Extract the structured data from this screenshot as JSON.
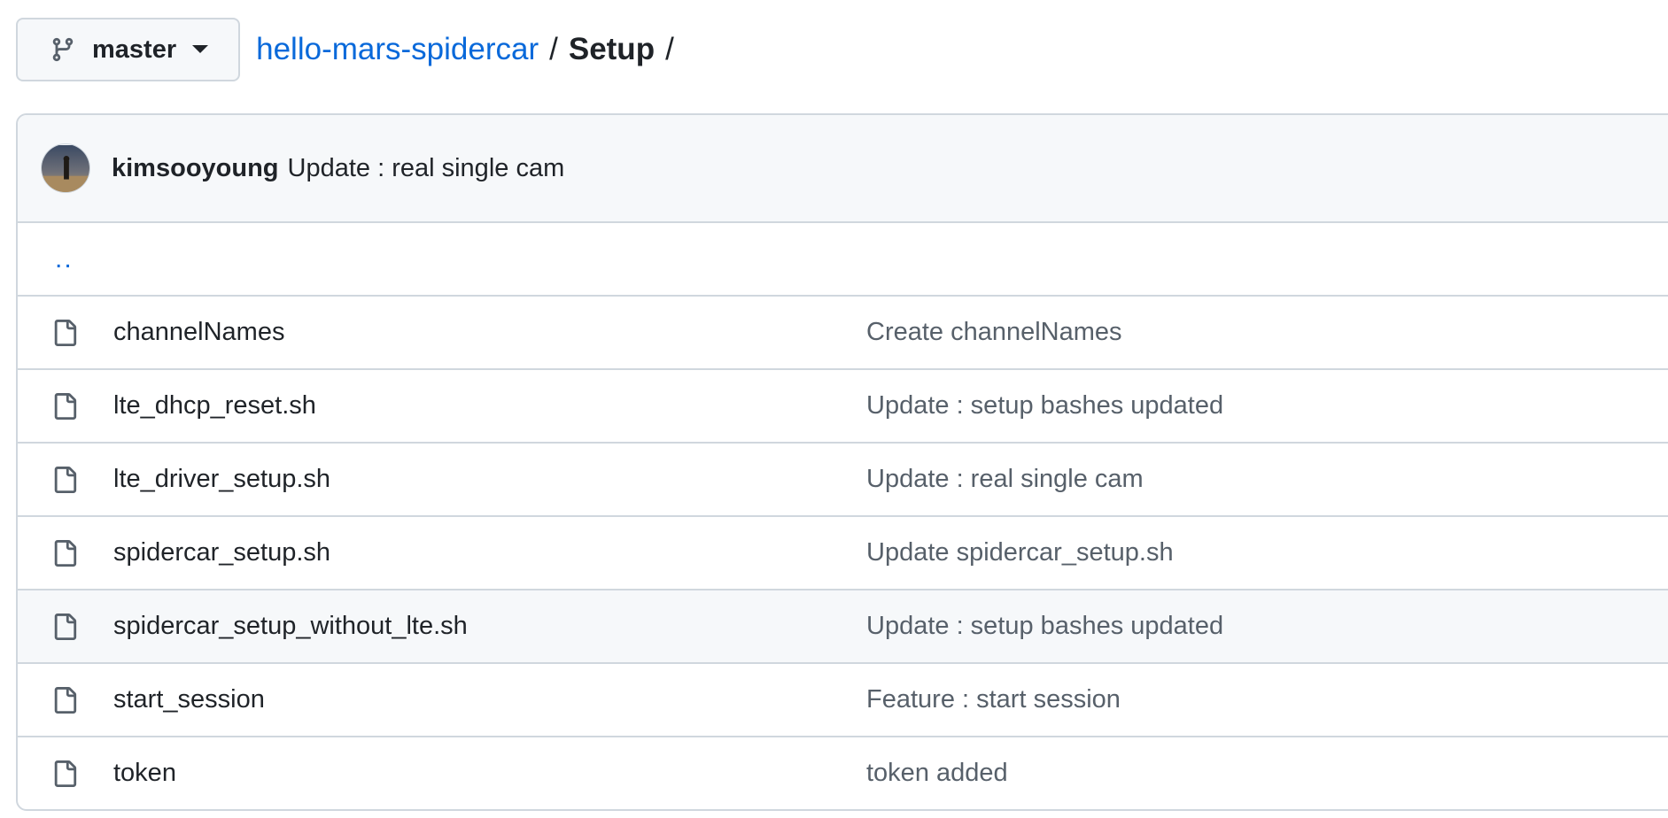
{
  "branch": {
    "label": "master",
    "icon": "git-branch-icon"
  },
  "breadcrumb": {
    "repo": "hello-mars-spidercar",
    "separator": "/",
    "folder": "Setup",
    "trailing": "/"
  },
  "latest_commit": {
    "author": "kimsooyoung",
    "message": "Update : real single cam"
  },
  "parent_dir": {
    "label": ".."
  },
  "files": [
    {
      "name": "channelNames",
      "commit": "Create channelNames"
    },
    {
      "name": "lte_dhcp_reset.sh",
      "commit": "Update : setup bashes updated"
    },
    {
      "name": "lte_driver_setup.sh",
      "commit": "Update : real single cam"
    },
    {
      "name": "spidercar_setup.sh",
      "commit": "Update spidercar_setup.sh"
    },
    {
      "name": "spidercar_setup_without_lte.sh",
      "commit": "Update : setup bashes updated"
    },
    {
      "name": "start_session",
      "commit": "Feature : start session"
    },
    {
      "name": "token",
      "commit": "token added"
    }
  ],
  "colors": {
    "link": "#0969da",
    "border": "#d0d7de",
    "header_bg": "#f6f8fa",
    "muted_text": "#57606a"
  }
}
